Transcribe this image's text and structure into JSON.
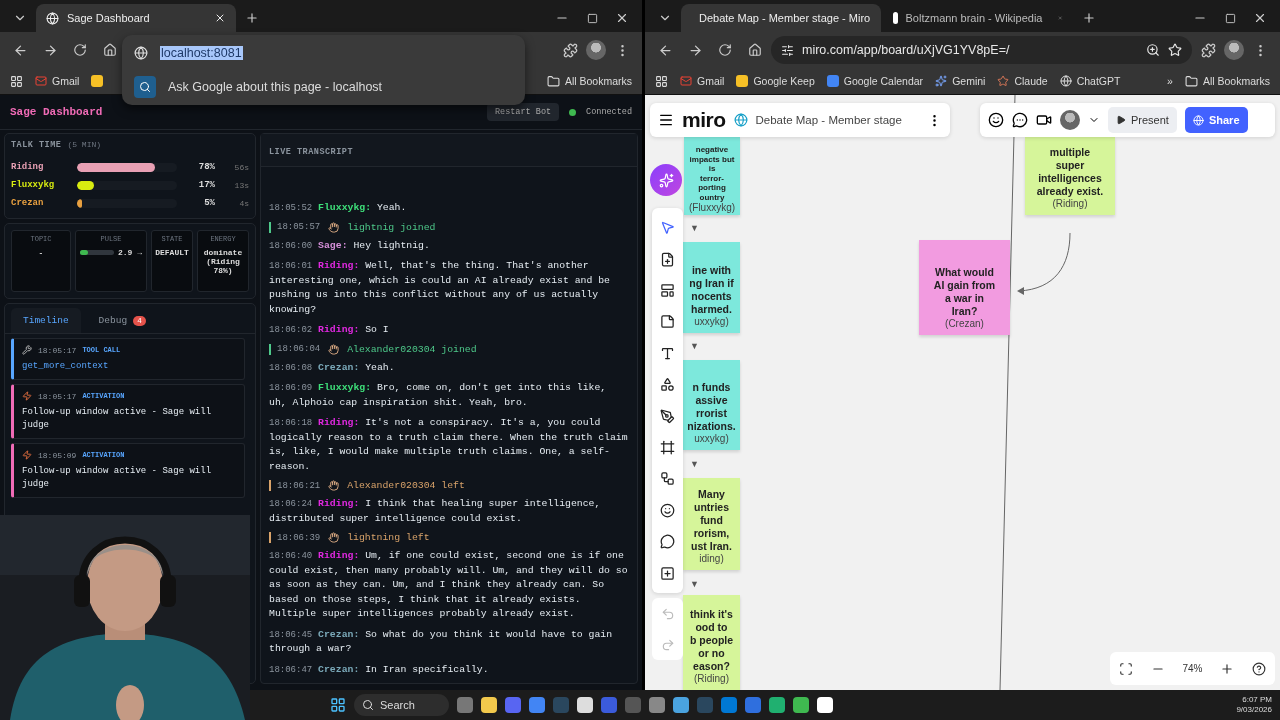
{
  "left_window": {
    "tabs": [
      {
        "title": "Sage Dashboard",
        "selected": true
      }
    ],
    "omnibox": {
      "address": "localhost:8081",
      "suggestion": "Ask Google about this page",
      "separator": "-",
      "detail": "localhost"
    },
    "bookmarks": [
      {
        "kind": "gmail",
        "label": "Gmail"
      },
      {
        "kind": "keep"
      }
    ],
    "all_bookmarks": "All Bookmarks",
    "app": {
      "title": "Sage Dashboard",
      "restart": "Restart Bot",
      "status": {
        "label": "Connected",
        "connected": true
      },
      "talk_time": {
        "title": "TALK TIME",
        "subtitle": "(5 MIN)",
        "rows": [
          {
            "name": "Riding",
            "color": "#e8a0b4",
            "level": 0.78,
            "percent": "78%",
            "seconds": "56s"
          },
          {
            "name": "Fluxxykg",
            "color": "#d8ec10",
            "level": 0.17,
            "percent": "17%",
            "seconds": "13s"
          },
          {
            "name": "Crezan",
            "color": "#e8a040",
            "level": 0.05,
            "percent": "5%",
            "seconds": "4s"
          }
        ]
      },
      "stats": [
        {
          "kind": "text",
          "label": "TOPIC",
          "value": "-"
        },
        {
          "kind": "meter",
          "label": "PULSE",
          "level": 0.25,
          "value": "2.9 →"
        },
        {
          "kind": "text",
          "label": "STATE",
          "value": "DEFAULT"
        },
        {
          "kind": "text",
          "label": "ENERGY",
          "value": "dominate (Riding 78%)"
        }
      ],
      "tabs": [
        {
          "label": "Timeline",
          "selected": true
        },
        {
          "label": "Debug",
          "selected": false,
          "badge": "4"
        }
      ],
      "timeline": [
        {
          "kind": "tool",
          "time": "18:05:17",
          "type": "TOOL CALL",
          "message": "get_more_context"
        },
        {
          "kind": "activation",
          "time": "18:05:17",
          "type": "ACTIVATION",
          "message": "Follow-up window active - Sage will judge"
        },
        {
          "kind": "activation",
          "time": "18:05:09",
          "type": "ACTIVATION",
          "message": "Follow-up window active - Sage will judge"
        }
      ],
      "transcript": {
        "title": "LIVE TRANSCRIPT",
        "entries": [
          {
            "kind": "message",
            "time": "18:05:52",
            "speaker": "Fluxxykg:",
            "color": "#3ee07a",
            "text": "Yeah."
          },
          {
            "kind": "event",
            "time": "18:05:57",
            "text": "lightnig joined",
            "color": "#4ec98a"
          },
          {
            "kind": "message",
            "time": "18:06:00",
            "speaker": "Sage:",
            "color": "#d48fd8",
            "text": "Hey lightnig."
          },
          {
            "kind": "message",
            "time": "18:06:01",
            "speaker": "Riding:",
            "color": "#e028e0",
            "text": "Well, that's the thing. That's another interesting one, which is could an AI already exist and be pushing us into this conflict without any of us actually knowing?"
          },
          {
            "kind": "message",
            "time": "18:06:02",
            "speaker": "Riding:",
            "color": "#e028e0",
            "text": "So I"
          },
          {
            "kind": "event",
            "time": "18:06:04",
            "text": "Alexander020304 joined",
            "color": "#4ec98a"
          },
          {
            "kind": "message",
            "time": "18:06:08",
            "speaker": "Crezan:",
            "color": "#7aa8b8",
            "text": "Yeah."
          },
          {
            "kind": "message",
            "time": "18:06:09",
            "speaker": "Fluxxykg:",
            "color": "#3ee07a",
            "text": "Bro, come on, don't get into this like, uh, Alphoio cap inspiration shit. Yeah, bro."
          },
          {
            "kind": "message",
            "time": "18:06:18",
            "speaker": "Riding:",
            "color": "#e028e0",
            "text": "It's not a conspiracy. It's a, you could logically reason to a truth claim there. When the truth claim is, like, I would make multiple truth claims. One, a self-reason."
          },
          {
            "kind": "event",
            "time": "18:06:21",
            "text": "Alexander020304 left",
            "color": "#d9a36a"
          },
          {
            "kind": "message",
            "time": "18:06:24",
            "speaker": "Riding:",
            "color": "#e028e0",
            "text": "I think that healing super intelligence, distributed super intelligence could exist."
          },
          {
            "kind": "event",
            "time": "18:06:39",
            "text": "lightning left",
            "color": "#d9a36a"
          },
          {
            "kind": "message",
            "time": "18:06:40",
            "speaker": "Riding:",
            "color": "#e028e0",
            "text": "Um, if one could exist, second one is if one could exist, then many probably will. Um, and they will do so as soon as they can. Um, and I think they already can. So based on those steps, I think that it already exists. Multiple super intelligences probably already exist."
          },
          {
            "kind": "message",
            "time": "18:06:45",
            "speaker": "Crezan:",
            "color": "#7aa8b8",
            "text": "So what do you think it would have to gain through a war?"
          },
          {
            "kind": "message",
            "time": "18:06:47",
            "speaker": "Crezan:",
            "color": "#7aa8b8",
            "text": "In Iran specifically."
          }
        ]
      }
    }
  },
  "right_window": {
    "tabs": [
      {
        "title": "Debate Map - Member stage - Miro",
        "kind": "miro",
        "selected": true
      },
      {
        "title": "Boltzmann brain - Wikipedia",
        "kind": "wiki",
        "selected": false
      }
    ],
    "address": "miro.com/app/board/uXjVG1YV8pE=/",
    "bookmarks": [
      {
        "kind": "gmail",
        "label": "Gmail"
      },
      {
        "kind": "keep",
        "label": "Google Keep"
      },
      {
        "kind": "calendar",
        "label": "Google Calendar"
      },
      {
        "kind": "gemini",
        "label": "Gemini"
      },
      {
        "kind": "claude",
        "label": "Claude"
      },
      {
        "kind": "chatgpt",
        "label": "ChatGPT"
      }
    ],
    "overflow": "»",
    "all_bookmarks": "All Bookmarks",
    "miro": {
      "logo": "miro",
      "board_title": "Debate Map - Member stage",
      "present": "Present",
      "share": "Share",
      "zoom": "74%",
      "notes": [
        {
          "text": "negative\nimpacts but is\nterror-\nporting\nountry",
          "author": "(Fluxxykg)",
          "color": "#7de8dc",
          "marker": "▼"
        },
        {
          "text": "ine with\nng Iran if\nnocents\nharmed.",
          "author": "uxxykg)",
          "color": "#7de8dc",
          "marker": "▼"
        },
        {
          "text": "n funds\nassive\nrrorist\nnizations.",
          "author": "uxxykg)",
          "color": "#7de8dc",
          "marker": "▼"
        },
        {
          "text": "Many\nuntries\nfund\nrorism,\nust Iran.",
          "author": "iding)",
          "color": "#d6f59a",
          "marker": "▼"
        },
        {
          "text": "think it's\nood to\nb people\nor no\neason?",
          "author": "(Riding)",
          "color": "#d6f59a"
        },
        {
          "text": "multiple\nsuper\nintelligences\nalready exist.",
          "author": "(Riding)",
          "color": "#d6f59a"
        },
        {
          "text": "What would\nAI gain from\na war in\nIran?",
          "author": "(Crezan)",
          "color": "#f29be0"
        }
      ]
    }
  },
  "taskbar": {
    "search": "Search",
    "time": "6:07 PM",
    "date": "9/03/2026"
  }
}
